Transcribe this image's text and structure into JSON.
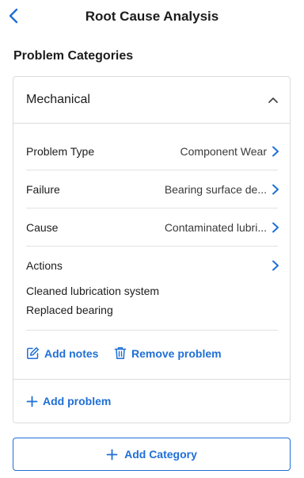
{
  "header": {
    "title": "Root Cause Analysis",
    "back_icon": "chevron-left-icon"
  },
  "section_title": "Problem Categories",
  "category": {
    "name": "Mechanical",
    "expanded": true,
    "rows": [
      {
        "label": "Problem Type",
        "value": "Component Wear"
      },
      {
        "label": "Failure",
        "value": "Bearing surface de..."
      },
      {
        "label": "Cause",
        "value": "Contaminated lubri..."
      }
    ],
    "actions": {
      "label": "Actions",
      "items": [
        "Cleaned lubrication system",
        "Replaced bearing"
      ]
    },
    "add_notes_label": "Add notes",
    "remove_problem_label": "Remove problem",
    "add_problem_label": "Add problem"
  },
  "add_category_label": "Add Category",
  "colors": {
    "accent": "#1f6fd6",
    "text": "#1c1c1e",
    "border": "#dcdcdf"
  }
}
